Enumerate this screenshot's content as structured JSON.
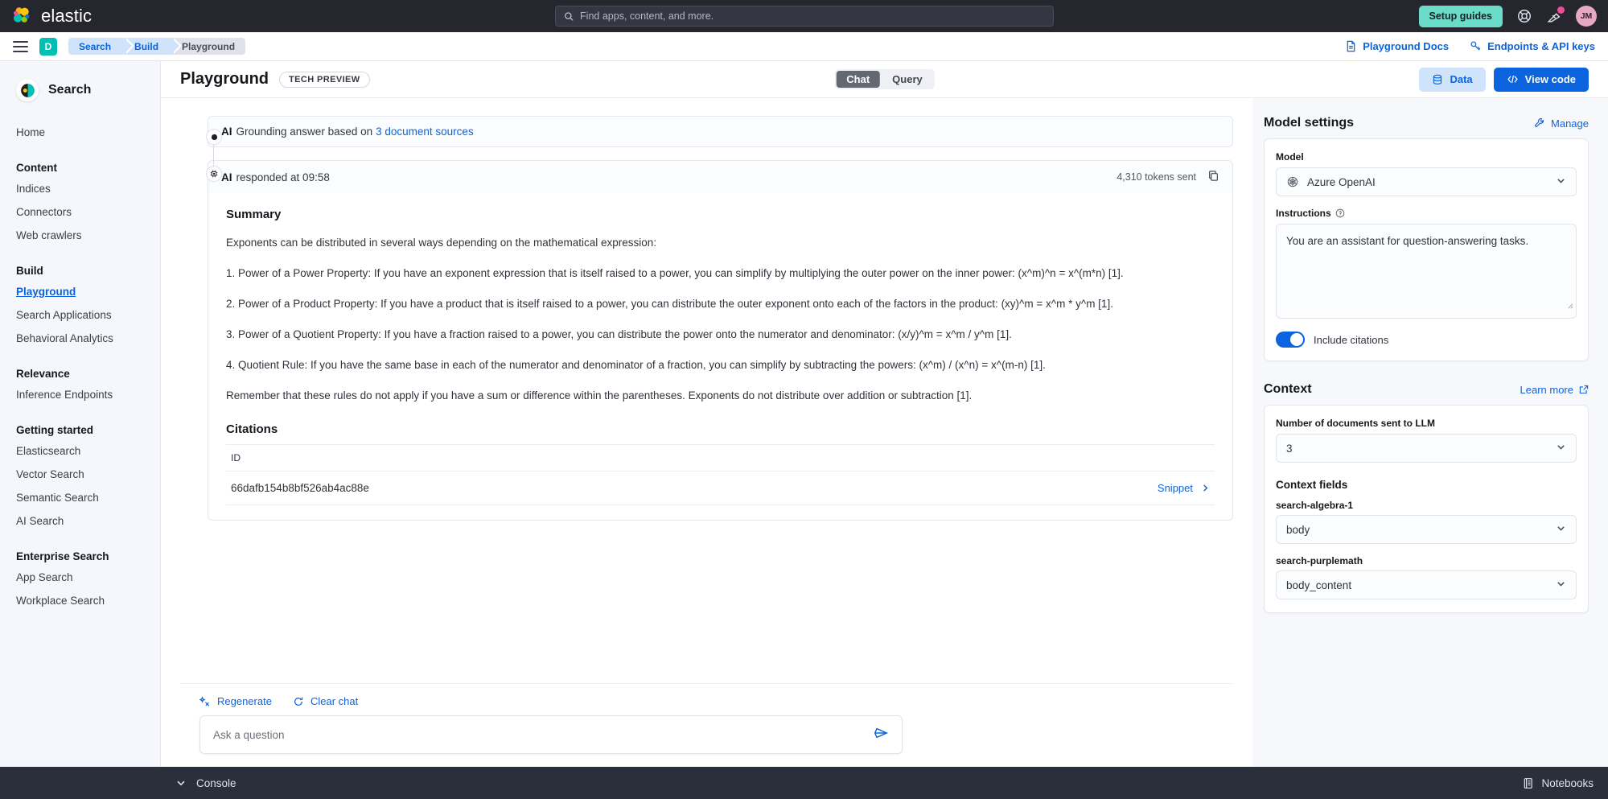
{
  "topbar": {
    "brand": "elastic",
    "search_placeholder": "Find apps, content, and more.",
    "setup_guides": "Setup guides",
    "avatar_initials": "JM"
  },
  "crumbbar": {
    "space_initial": "D",
    "crumbs": [
      "Search",
      "Build",
      "Playground"
    ],
    "playground_docs": "Playground Docs",
    "endpoints_api_keys": "Endpoints & API keys"
  },
  "sidebar": {
    "title": "Search",
    "home": "Home",
    "groups": [
      {
        "label": "Content",
        "items": [
          "Indices",
          "Connectors",
          "Web crawlers"
        ]
      },
      {
        "label": "Build",
        "items": [
          "Playground",
          "Search Applications",
          "Behavioral Analytics"
        ]
      },
      {
        "label": "Relevance",
        "items": [
          "Inference Endpoints"
        ]
      },
      {
        "label": "Getting started",
        "items": [
          "Elasticsearch",
          "Vector Search",
          "Semantic Search",
          "AI Search"
        ]
      },
      {
        "label": "Enterprise Search",
        "items": [
          "App Search",
          "Workplace Search"
        ]
      }
    ],
    "active_item": "Playground"
  },
  "page": {
    "title": "Playground",
    "tech_preview": "TECH PREVIEW",
    "tabs": [
      {
        "label": "Chat",
        "selected": true
      },
      {
        "label": "Query",
        "selected": false
      }
    ],
    "data_button": "Data",
    "view_code_button": "View code"
  },
  "chat": {
    "grounding_prefix": "AI",
    "grounding_text": "Grounding answer based on",
    "grounding_link": "3 document sources",
    "responded_prefix": "AI",
    "responded_text": "responded at 09:58",
    "tokens_sent": "4,310 tokens sent",
    "summary_heading": "Summary",
    "paragraphs": [
      "Exponents can be distributed in several ways depending on the mathematical expression:",
      "1. Power of a Power Property: If you have an exponent expression that is itself raised to a power, you can simplify by multiplying the outer power on the inner power: (x^m)^n = x^(m*n) [1].",
      "2. Power of a Product Property: If you have a product that is itself raised to a power, you can distribute the outer exponent onto each of the factors in the product: (xy)^m = x^m * y^m [1].",
      "3. Power of a Quotient Property: If you have a fraction raised to a power, you can distribute the power onto the numerator and denominator: (x/y)^m = x^m / y^m [1].",
      "4. Quotient Rule: If you have the same base in each of the numerator and denominator of a fraction, you can simplify by subtracting the powers: (x^m) / (x^n) = x^(m-n) [1].",
      "Remember that these rules do not apply if you have a sum or difference within the parentheses. Exponents do not distribute over addition or subtraction [1]."
    ],
    "citations_heading": "Citations",
    "citations_col_id": "ID",
    "citations": [
      {
        "id": "66dafb154b8bf526ab4ac88e",
        "action": "Snippet"
      }
    ],
    "regenerate": "Regenerate",
    "clear_chat": "Clear chat",
    "ask_placeholder": "Ask a question"
  },
  "model_settings": {
    "title": "Model settings",
    "manage": "Manage",
    "model_label": "Model",
    "model_value": "Azure OpenAI",
    "instructions_label": "Instructions",
    "instructions_value": "You are an assistant for question-answering tasks.",
    "include_citations": "Include citations",
    "include_citations_on": true
  },
  "context": {
    "title": "Context",
    "learn_more": "Learn more",
    "num_docs_label": "Number of documents sent to LLM",
    "num_docs_value": "3",
    "context_fields_label": "Context fields",
    "fields": [
      {
        "name": "search-algebra-1",
        "value": "body"
      },
      {
        "name": "search-purplemath",
        "value": "body_content"
      }
    ]
  },
  "console": {
    "label": "Console",
    "notebooks": "Notebooks"
  },
  "colors": {
    "accent_blue": "#0b64dd",
    "teal": "#00BFB3",
    "setup_green": "#6ADCC7",
    "dark_nav": "#25262E",
    "console_bg": "#2b2e3b",
    "badge_pink": "#F04E98"
  }
}
